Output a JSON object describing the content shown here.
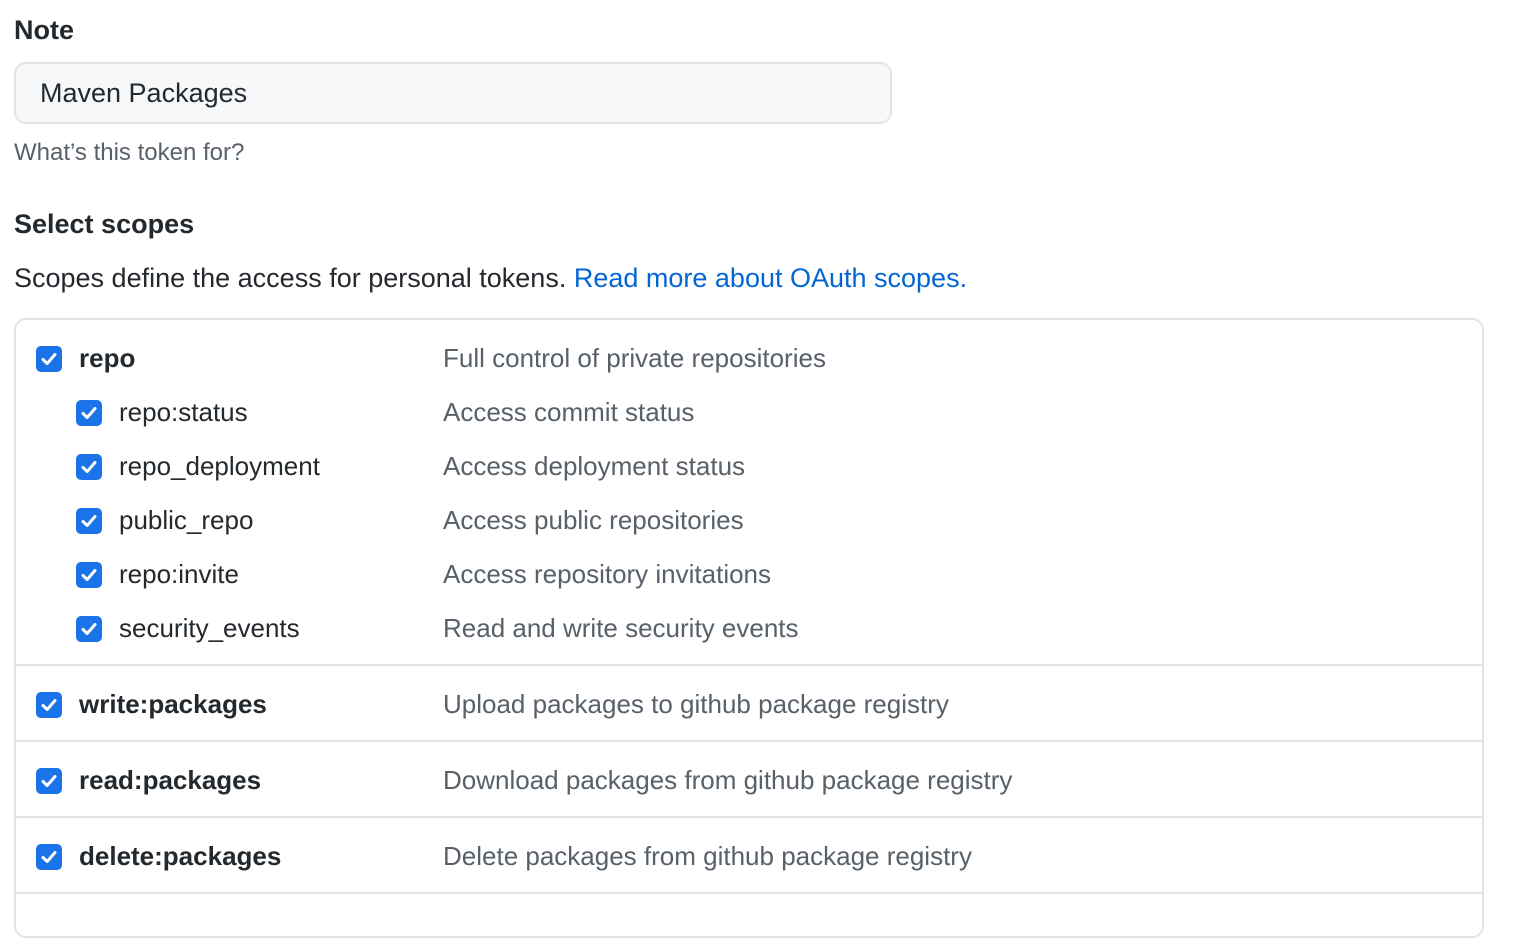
{
  "note": {
    "label": "Note",
    "value": "Maven Packages",
    "hint": "What’s this token for?"
  },
  "scopes": {
    "heading": "Select scopes",
    "description": "Scopes define the access for personal tokens.",
    "link_text": "Read more about OAuth scopes.",
    "items": [
      {
        "name": "repo",
        "description": "Full control of private repositories",
        "checked": true,
        "level": "parent"
      },
      {
        "name": "repo:status",
        "description": "Access commit status",
        "checked": true,
        "level": "child"
      },
      {
        "name": "repo_deployment",
        "description": "Access deployment status",
        "checked": true,
        "level": "child"
      },
      {
        "name": "public_repo",
        "description": "Access public repositories",
        "checked": true,
        "level": "child"
      },
      {
        "name": "repo:invite",
        "description": "Access repository invitations",
        "checked": true,
        "level": "child"
      },
      {
        "name": "security_events",
        "description": "Read and write security events",
        "checked": true,
        "level": "child"
      },
      {
        "name": "write:packages",
        "description": "Upload packages to github package registry",
        "checked": true,
        "level": "parent"
      },
      {
        "name": "read:packages",
        "description": "Download packages from github package registry",
        "checked": true,
        "level": "parent"
      },
      {
        "name": "delete:packages",
        "description": "Delete packages from github package registry",
        "checked": true,
        "level": "parent"
      }
    ]
  },
  "colors": {
    "checkbox": "#1a73e8",
    "link": "#0366d6",
    "border": "#e1e4e8",
    "muted_text": "#586069"
  },
  "icons": {
    "checkbox": "checkmark-icon"
  }
}
